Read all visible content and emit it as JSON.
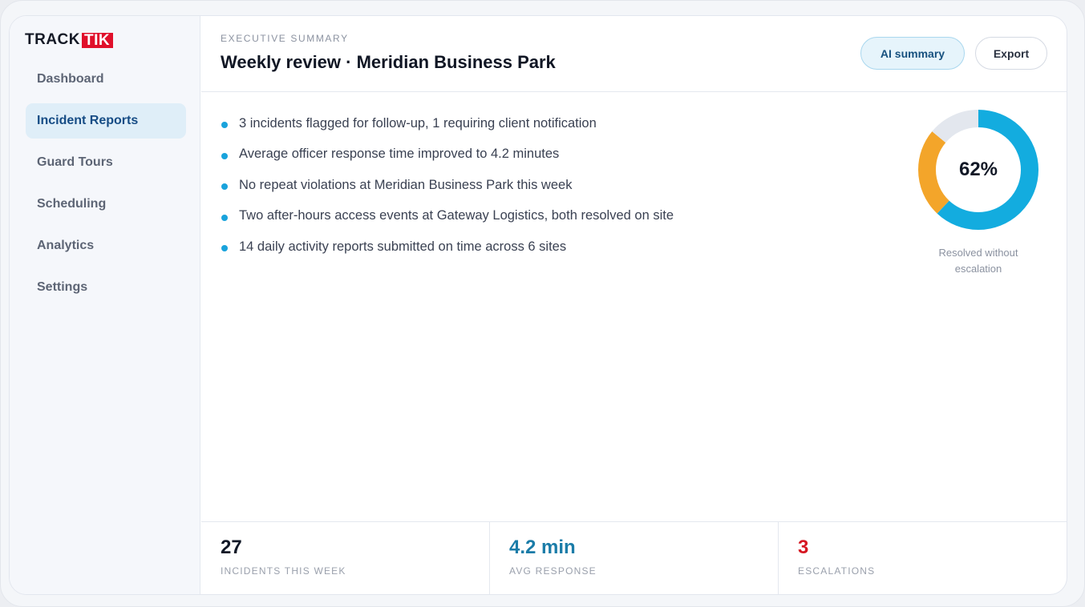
{
  "brand": {
    "part1": "TRACK",
    "part2": "TIK",
    "accent": "#e0102b"
  },
  "sidebar": {
    "items": [
      {
        "label": "Dashboard",
        "active": false
      },
      {
        "label": "Incident Reports",
        "active": true
      },
      {
        "label": "Guard Tours",
        "active": false
      },
      {
        "label": "Scheduling",
        "active": false
      },
      {
        "label": "Analytics",
        "active": false
      },
      {
        "label": "Settings",
        "active": false
      }
    ]
  },
  "header": {
    "eyebrow": "EXECUTIVE SUMMARY",
    "title": "Weekly review · Meridian Business Park",
    "ai_button": "AI summary",
    "export_button": "Export"
  },
  "summary": {
    "bullets": [
      "3 incidents flagged for follow-up, 1 requiring client notification",
      "Average officer response time improved to 4.2 minutes",
      "No repeat violations at Meridian Business Park this week",
      "Two after-hours access events at Gateway Logistics, both resolved on site",
      "14 daily activity reports submitted on time across 6 sites"
    ],
    "bullet_color": "#19a3dc"
  },
  "donut": {
    "label": "62%",
    "caption": "Resolved without escalation",
    "segments": [
      {
        "fraction": 0.62,
        "color": "#13acdf"
      },
      {
        "fraction": 0.24,
        "color": "#f3a52a"
      },
      {
        "fraction": 0.14,
        "color": "#e3e7ee"
      }
    ]
  },
  "stats": [
    {
      "value": "27",
      "label": "INCIDENTS THIS WEEK",
      "color": "#111827"
    },
    {
      "value": "4.2 min",
      "label": "AVG RESPONSE",
      "color": "#1a7ca8"
    },
    {
      "value": "3",
      "label": "ESCALATIONS",
      "color": "#d61621"
    }
  ]
}
